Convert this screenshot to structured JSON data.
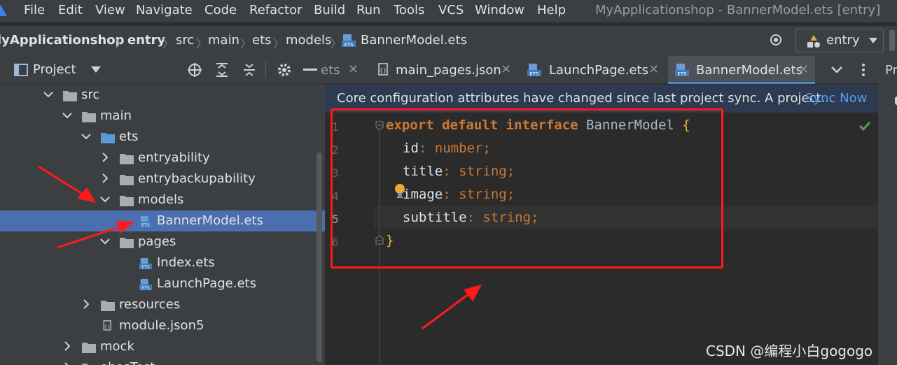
{
  "menu": {
    "items": [
      "File",
      "Edit",
      "View",
      "Navigate",
      "Code",
      "Refactor",
      "Build",
      "Run",
      "Tools",
      "VCS",
      "Window",
      "Help"
    ],
    "window_title": "MyApplicationshop - BannerModel.ets [entry]"
  },
  "breadcrumb": {
    "project": "lyApplicationshop",
    "module": "entry",
    "parts": [
      "src",
      "main",
      "ets",
      "models"
    ],
    "file": "BannerModel.ets",
    "run_config": "entry"
  },
  "project_panel": {
    "title": "Project",
    "tree": [
      {
        "label": "src",
        "depth": 0,
        "chevron": "down",
        "icon": "folder"
      },
      {
        "label": "main",
        "depth": 1,
        "chevron": "down",
        "icon": "folder"
      },
      {
        "label": "ets",
        "depth": 2,
        "chevron": "down",
        "icon": "folder-blue"
      },
      {
        "label": "entryability",
        "depth": 3,
        "chevron": "right",
        "icon": "folder"
      },
      {
        "label": "entrybackupability",
        "depth": 3,
        "chevron": "right",
        "icon": "folder"
      },
      {
        "label": "models",
        "depth": 3,
        "chevron": "down",
        "icon": "folder"
      },
      {
        "label": "BannerModel.ets",
        "depth": 4,
        "chevron": "none",
        "icon": "ets-file",
        "selected": true
      },
      {
        "label": "pages",
        "depth": 3,
        "chevron": "down",
        "icon": "folder"
      },
      {
        "label": "Index.ets",
        "depth": 4,
        "chevron": "none",
        "icon": "ets-file"
      },
      {
        "label": "LaunchPage.ets",
        "depth": 4,
        "chevron": "none",
        "icon": "ets-file"
      },
      {
        "label": "resources",
        "depth": 2,
        "chevron": "right",
        "icon": "folder"
      },
      {
        "label": "module.json5",
        "depth": 2,
        "chevron": "none",
        "icon": "json-file"
      },
      {
        "label": "mock",
        "depth": 1,
        "chevron": "right",
        "icon": "folder"
      },
      {
        "label": "ohosTest",
        "depth": 1,
        "chevron": "right",
        "icon": "folder"
      }
    ]
  },
  "tabs": [
    {
      "label": "ets",
      "active": false
    },
    {
      "label": "main_pages.json",
      "active": false
    },
    {
      "label": "LaunchPage.ets",
      "active": false
    },
    {
      "label": "BannerModel.ets",
      "active": true
    }
  ],
  "right_strip_label": "Pr",
  "banner": {
    "message": "Core configuration attributes have changed since last project sync. A project...",
    "link": "Sync Now"
  },
  "editor": {
    "line_numbers": [
      "1",
      "2",
      "3",
      "4",
      "5",
      "6"
    ],
    "lines": [
      {
        "kw1": "export",
        "kw2": "default",
        "kw3": "interface",
        "name": "BannerModel",
        "open": "{"
      },
      {
        "prop": "id",
        "type": "number"
      },
      {
        "prop": "title",
        "type": "string"
      },
      {
        "prop": "image",
        "type": "string"
      },
      {
        "prop": "subtitle",
        "type": "string"
      },
      {
        "close": "}"
      }
    ]
  },
  "watermark": "CSDN @编程小白gogogo",
  "colors": {
    "annotation": "#ff1a1a",
    "selection": "#4b6eaf",
    "link": "#589df6"
  }
}
